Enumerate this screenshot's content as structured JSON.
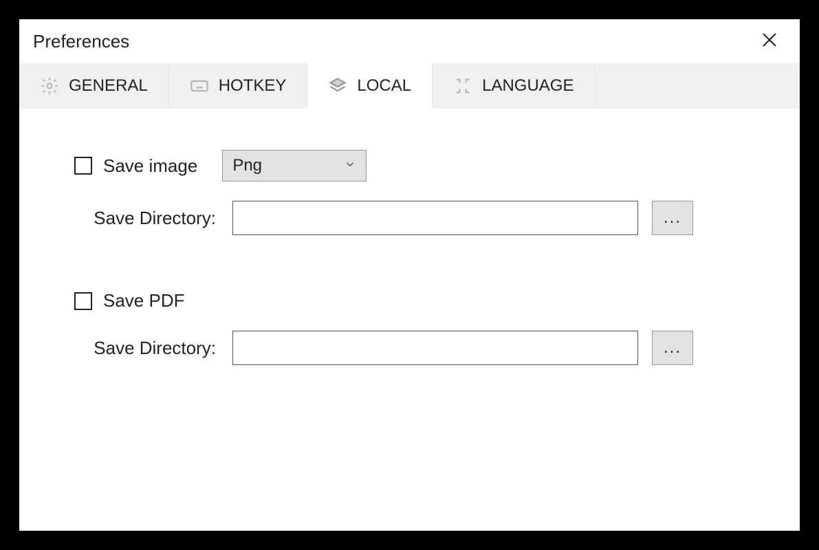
{
  "window": {
    "title": "Preferences"
  },
  "tabs": {
    "general": "GENERAL",
    "hotkey": "HOTKEY",
    "local": "LOCAL",
    "language": "LANGUAGE",
    "active": "local"
  },
  "local": {
    "save_image": {
      "label": "Save image",
      "checked": false,
      "format_selected": "Png",
      "directory_label": "Save Directory:",
      "directory_value": "",
      "browse_label": "..."
    },
    "save_pdf": {
      "label": "Save PDF",
      "checked": false,
      "directory_label": "Save Directory:",
      "directory_value": "",
      "browse_label": "..."
    }
  }
}
